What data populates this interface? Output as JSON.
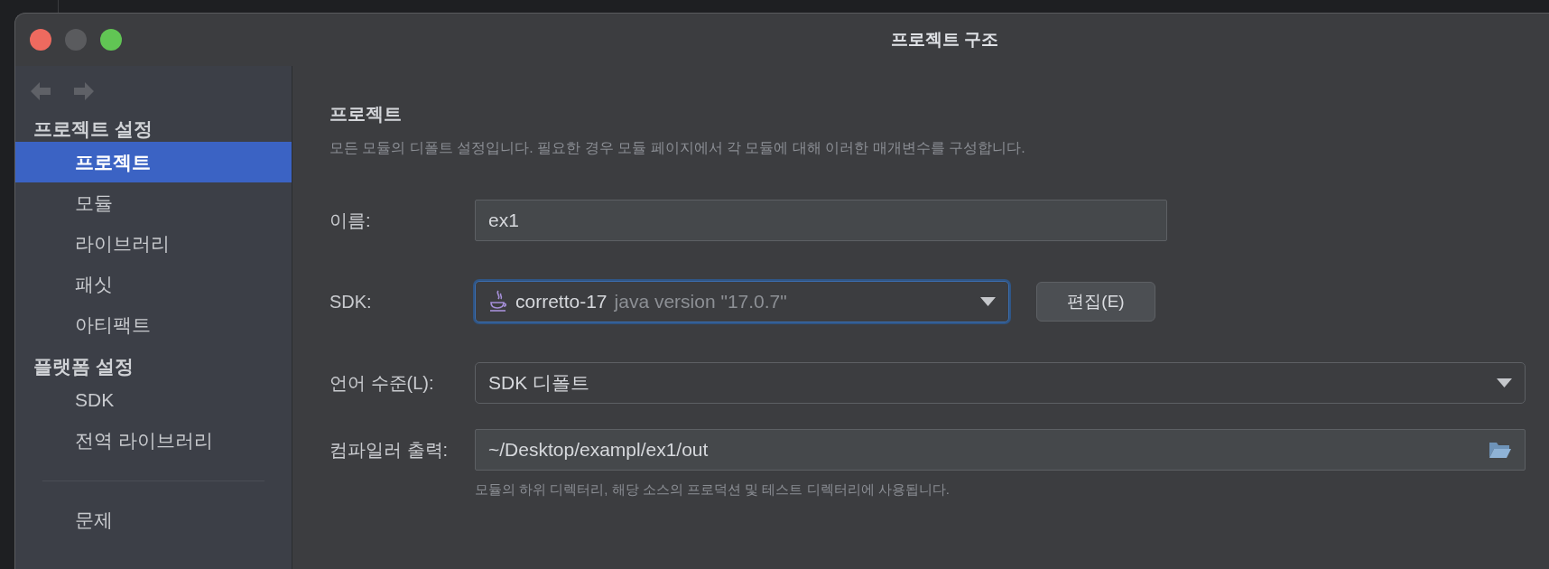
{
  "window": {
    "title": "프로젝트 구조"
  },
  "sidebar": {
    "sections": [
      {
        "title": "프로젝트 설정",
        "items": [
          {
            "label": "프로젝트",
            "selected": true
          },
          {
            "label": "모듈",
            "selected": false
          },
          {
            "label": "라이브러리",
            "selected": false
          },
          {
            "label": "패싯",
            "selected": false
          },
          {
            "label": "아티팩트",
            "selected": false
          }
        ]
      },
      {
        "title": "플랫폼 설정",
        "items": [
          {
            "label": "SDK",
            "selected": false
          },
          {
            "label": "전역 라이브러리",
            "selected": false
          }
        ]
      }
    ],
    "footer_items": [
      {
        "label": "문제",
        "selected": false
      }
    ]
  },
  "panel": {
    "title": "프로젝트",
    "description": "모든 모듈의 디폴트 설정입니다. 필요한 경우 모듈 페이지에서 각 모듈에 대해 이러한 매개변수를 구성합니다.",
    "fields": [
      {
        "kind": "text",
        "label": "이름:",
        "value": "ex1"
      },
      {
        "kind": "sdk",
        "label": "SDK:",
        "value": "corretto-17",
        "detail": "java version \"17.0.7\"",
        "focused": true,
        "button": "편집(E)"
      },
      {
        "kind": "select",
        "label": "언어 수준(L):",
        "value": "SDK 디폴트"
      },
      {
        "kind": "path",
        "label": "컴파일러 출력:",
        "value": "~/Desktop/exampl/ex1/out",
        "hint": "모듈의 하위 디렉터리, 해당 소스의 프로덕션 및 테스트 디렉터리에 사용됩니다."
      }
    ]
  }
}
